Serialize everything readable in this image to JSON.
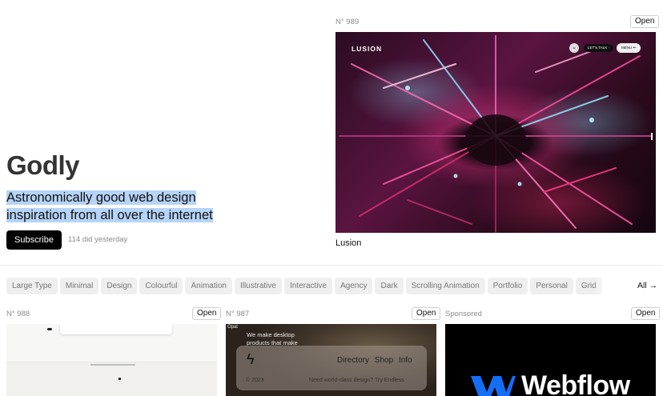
{
  "hero": {
    "title": "Godly",
    "tagline": "Astronomically good web design inspiration from all over the internet",
    "subscribe_label": "Subscribe",
    "subscriber_note": "114 did yesterday"
  },
  "featured": {
    "number": "N° 989",
    "open_label": "Open",
    "title": "Lusion",
    "preview": {
      "logo": "LUSION",
      "talk_label": "LET'S TALK  ·",
      "menu_label": "MENU  ••"
    }
  },
  "tags": [
    "Large Type",
    "Minimal",
    "Design",
    "Colourful",
    "Animation",
    "Illustrative",
    "Interactive",
    "Agency",
    "Dark",
    "Scrolling Animation",
    "Portfolio",
    "Personal",
    "Grid"
  ],
  "tags_all_label": "All →",
  "cards": [
    {
      "number": "N° 988",
      "open_label": "Open"
    },
    {
      "number": "N° 987",
      "open_label": "Open",
      "preview": {
        "brand": "Opal",
        "headline": "We make desktop products that make",
        "nav": "Directory Shop Info",
        "copyright": "© 2023",
        "cta": "Need world-class design? Try Endless"
      }
    },
    {
      "number": "Sponsored",
      "open_label": "Open",
      "preview": {
        "brand": "Webflow"
      }
    }
  ],
  "colors": {
    "highlight": "#b6d4f7",
    "primary_button": "#000000",
    "webflow_blue": "#146ef5"
  }
}
